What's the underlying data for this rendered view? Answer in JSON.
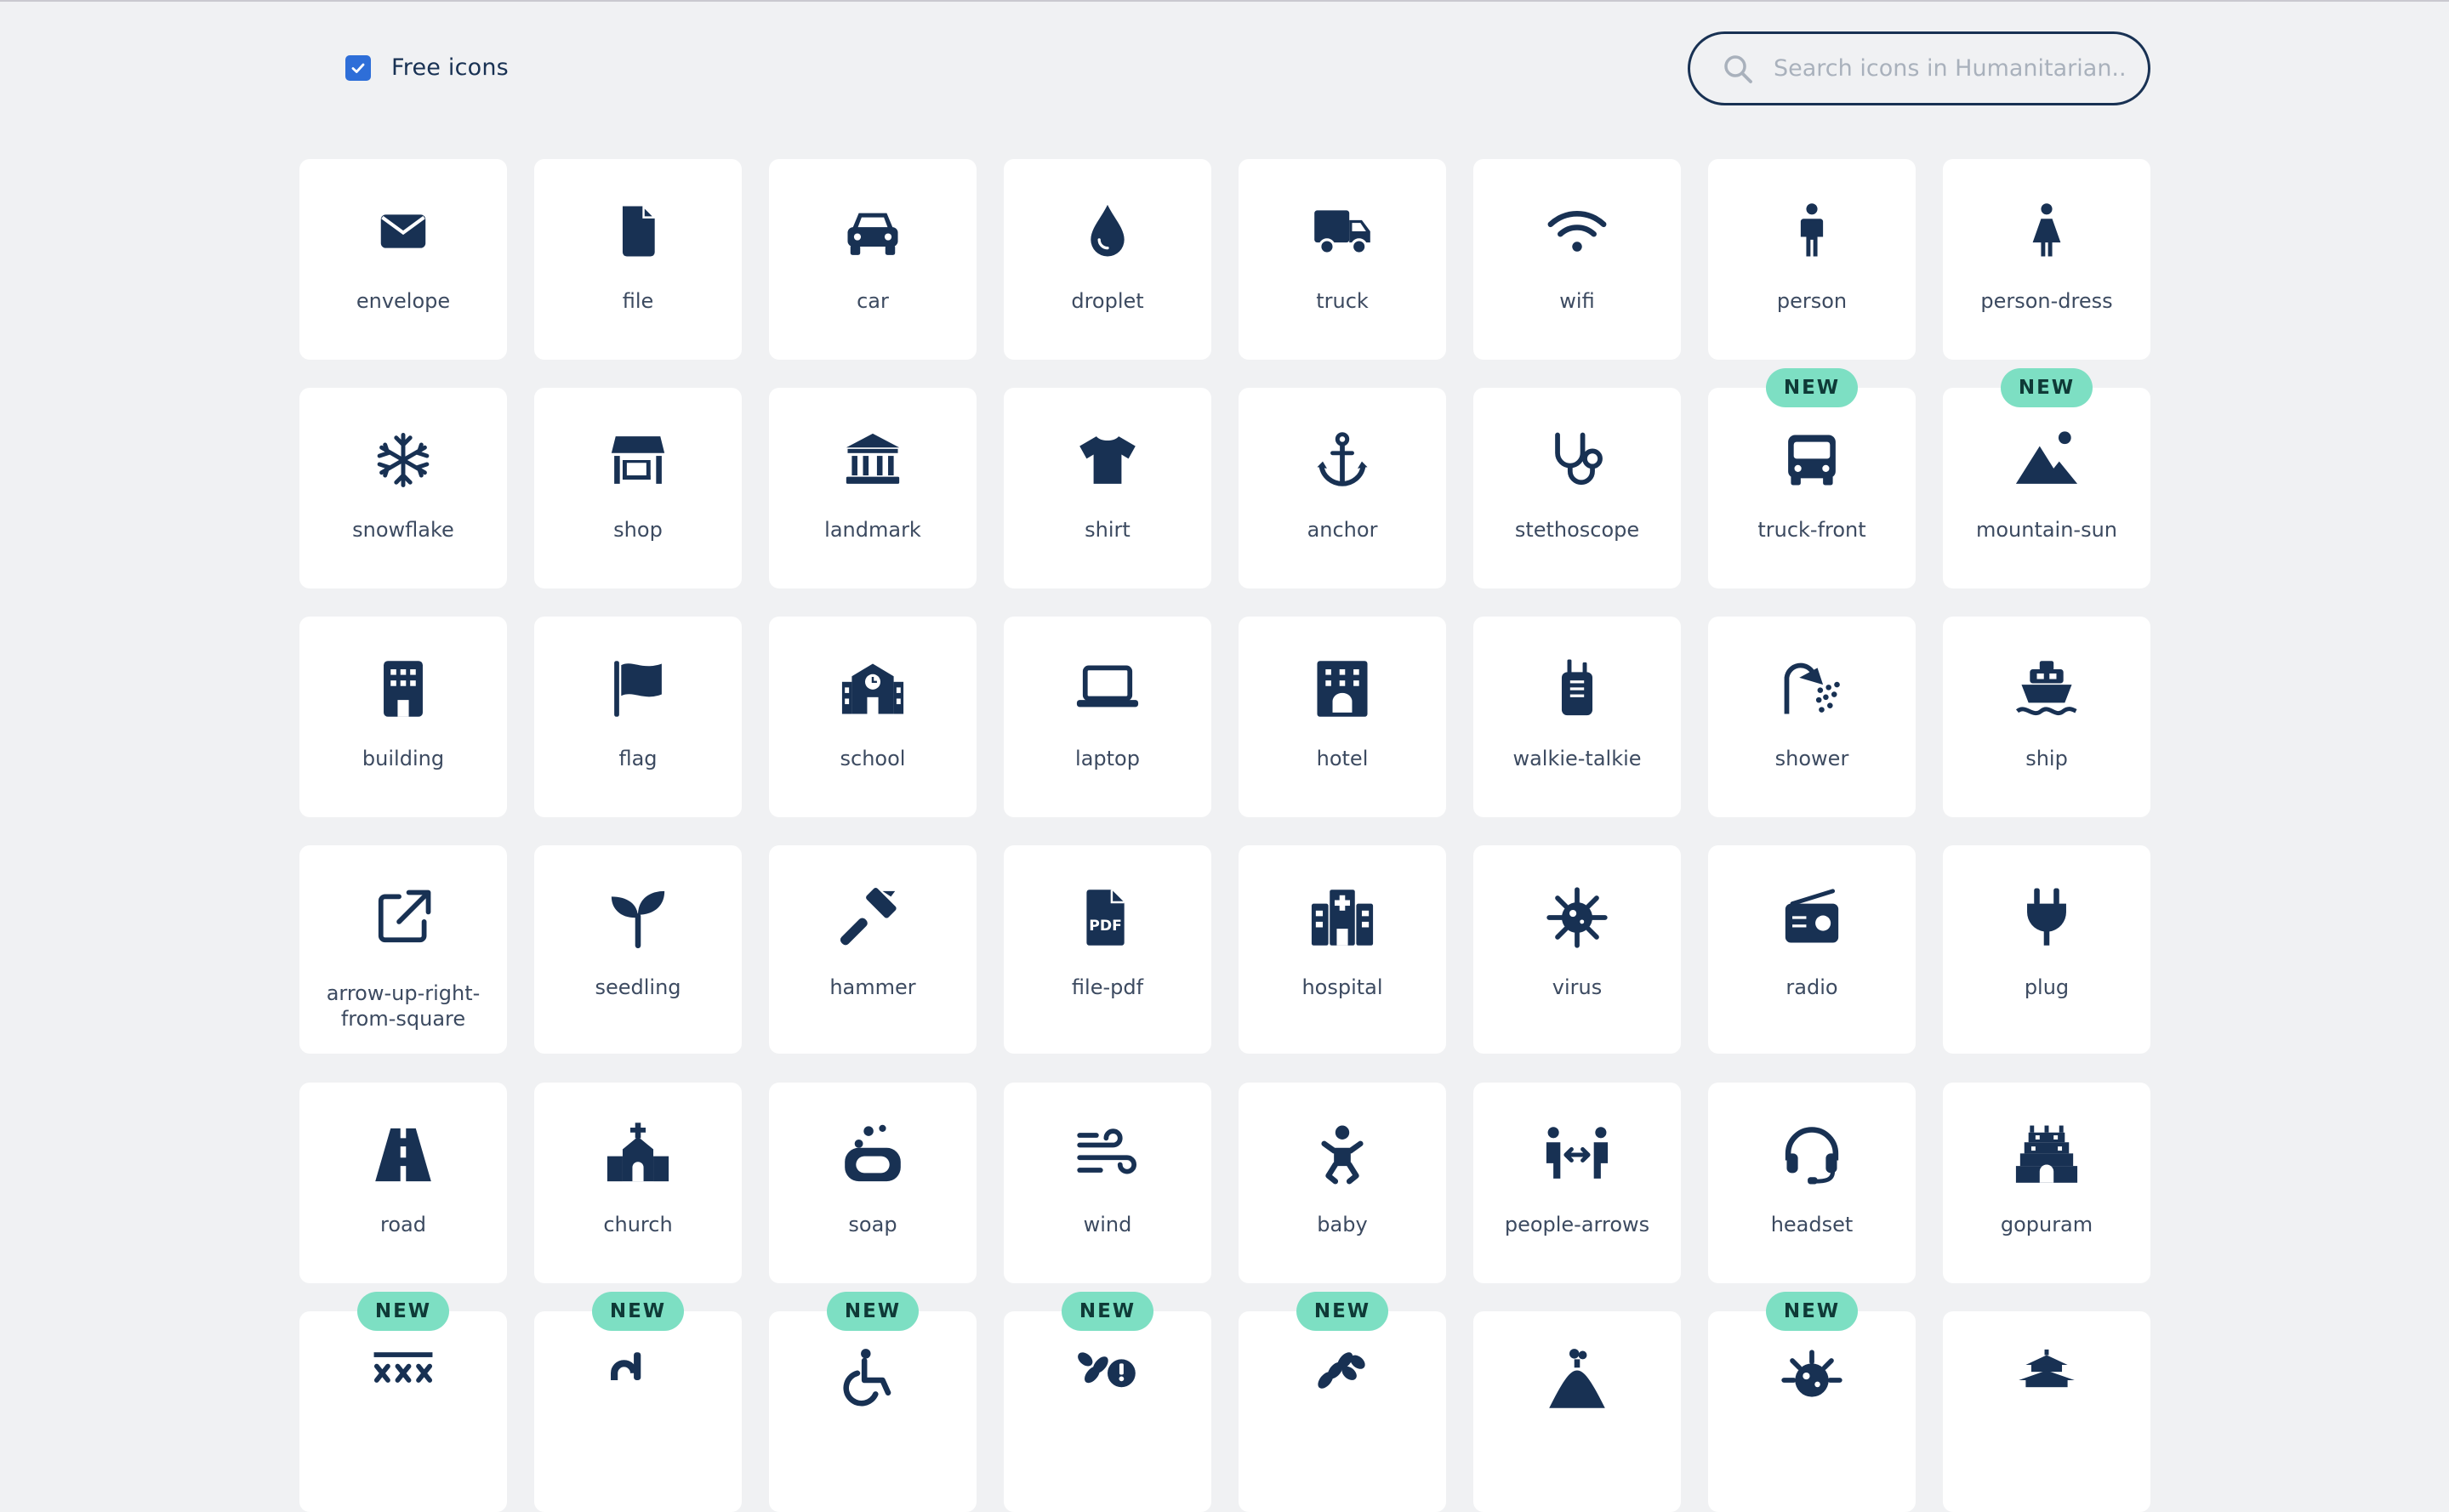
{
  "filter": {
    "free_icons_label": "Free icons",
    "free_icons_checked": true
  },
  "search": {
    "placeholder": "Search icons in Humanitarian.."
  },
  "badge_text": "NEW",
  "icons": [
    {
      "name": "envelope",
      "label": "envelope",
      "is_new": false
    },
    {
      "name": "file",
      "label": "file",
      "is_new": false
    },
    {
      "name": "car",
      "label": "car",
      "is_new": false
    },
    {
      "name": "droplet",
      "label": "droplet",
      "is_new": false
    },
    {
      "name": "truck",
      "label": "truck",
      "is_new": false
    },
    {
      "name": "wifi",
      "label": "wifi",
      "is_new": false
    },
    {
      "name": "person",
      "label": "person",
      "is_new": false
    },
    {
      "name": "person-dress",
      "label": "person-dress",
      "is_new": false
    },
    {
      "name": "snowflake",
      "label": "snowflake",
      "is_new": false
    },
    {
      "name": "shop",
      "label": "shop",
      "is_new": false
    },
    {
      "name": "landmark",
      "label": "landmark",
      "is_new": false
    },
    {
      "name": "shirt",
      "label": "shirt",
      "is_new": false
    },
    {
      "name": "anchor",
      "label": "anchor",
      "is_new": false
    },
    {
      "name": "stethoscope",
      "label": "stethoscope",
      "is_new": false
    },
    {
      "name": "truck-front",
      "label": "truck-front",
      "is_new": true
    },
    {
      "name": "mountain-sun",
      "label": "mountain-sun",
      "is_new": true
    },
    {
      "name": "building",
      "label": "building",
      "is_new": false
    },
    {
      "name": "flag",
      "label": "flag",
      "is_new": false
    },
    {
      "name": "school",
      "label": "school",
      "is_new": false
    },
    {
      "name": "laptop",
      "label": "laptop",
      "is_new": false
    },
    {
      "name": "hotel",
      "label": "hotel",
      "is_new": false
    },
    {
      "name": "walkie-talkie",
      "label": "walkie-talkie",
      "is_new": false
    },
    {
      "name": "shower",
      "label": "shower",
      "is_new": false
    },
    {
      "name": "ship",
      "label": "ship",
      "is_new": false
    },
    {
      "name": "arrow-up-right-from-square",
      "label": "arrow-up-right-\nfrom-square",
      "is_new": false
    },
    {
      "name": "seedling",
      "label": "seedling",
      "is_new": false
    },
    {
      "name": "hammer",
      "label": "hammer",
      "is_new": false
    },
    {
      "name": "file-pdf",
      "label": "file-pdf",
      "is_new": false
    },
    {
      "name": "hospital",
      "label": "hospital",
      "is_new": false
    },
    {
      "name": "virus",
      "label": "virus",
      "is_new": false
    },
    {
      "name": "radio",
      "label": "radio",
      "is_new": false
    },
    {
      "name": "plug",
      "label": "plug",
      "is_new": false
    },
    {
      "name": "road",
      "label": "road",
      "is_new": false
    },
    {
      "name": "church",
      "label": "church",
      "is_new": false
    },
    {
      "name": "soap",
      "label": "soap",
      "is_new": false
    },
    {
      "name": "wind",
      "label": "wind",
      "is_new": false
    },
    {
      "name": "baby",
      "label": "baby",
      "is_new": false
    },
    {
      "name": "people-arrows",
      "label": "people-arrows",
      "is_new": false
    },
    {
      "name": "headset",
      "label": "headset",
      "is_new": false
    },
    {
      "name": "gopuram",
      "label": "gopuram",
      "is_new": false
    },
    {
      "name": "road-barrier",
      "label": "",
      "is_new": true
    },
    {
      "name": "faucet-drip",
      "label": "",
      "is_new": true
    },
    {
      "name": "person-wheelchair",
      "label": "",
      "is_new": true
    },
    {
      "name": "wheat-awn-exclamation",
      "label": "",
      "is_new": true
    },
    {
      "name": "wheat-awn",
      "label": "",
      "is_new": true
    },
    {
      "name": "mound",
      "label": "",
      "is_new": false
    },
    {
      "name": "virus-covid",
      "label": "",
      "is_new": true
    },
    {
      "name": "vihara",
      "label": "",
      "is_new": false
    }
  ]
}
